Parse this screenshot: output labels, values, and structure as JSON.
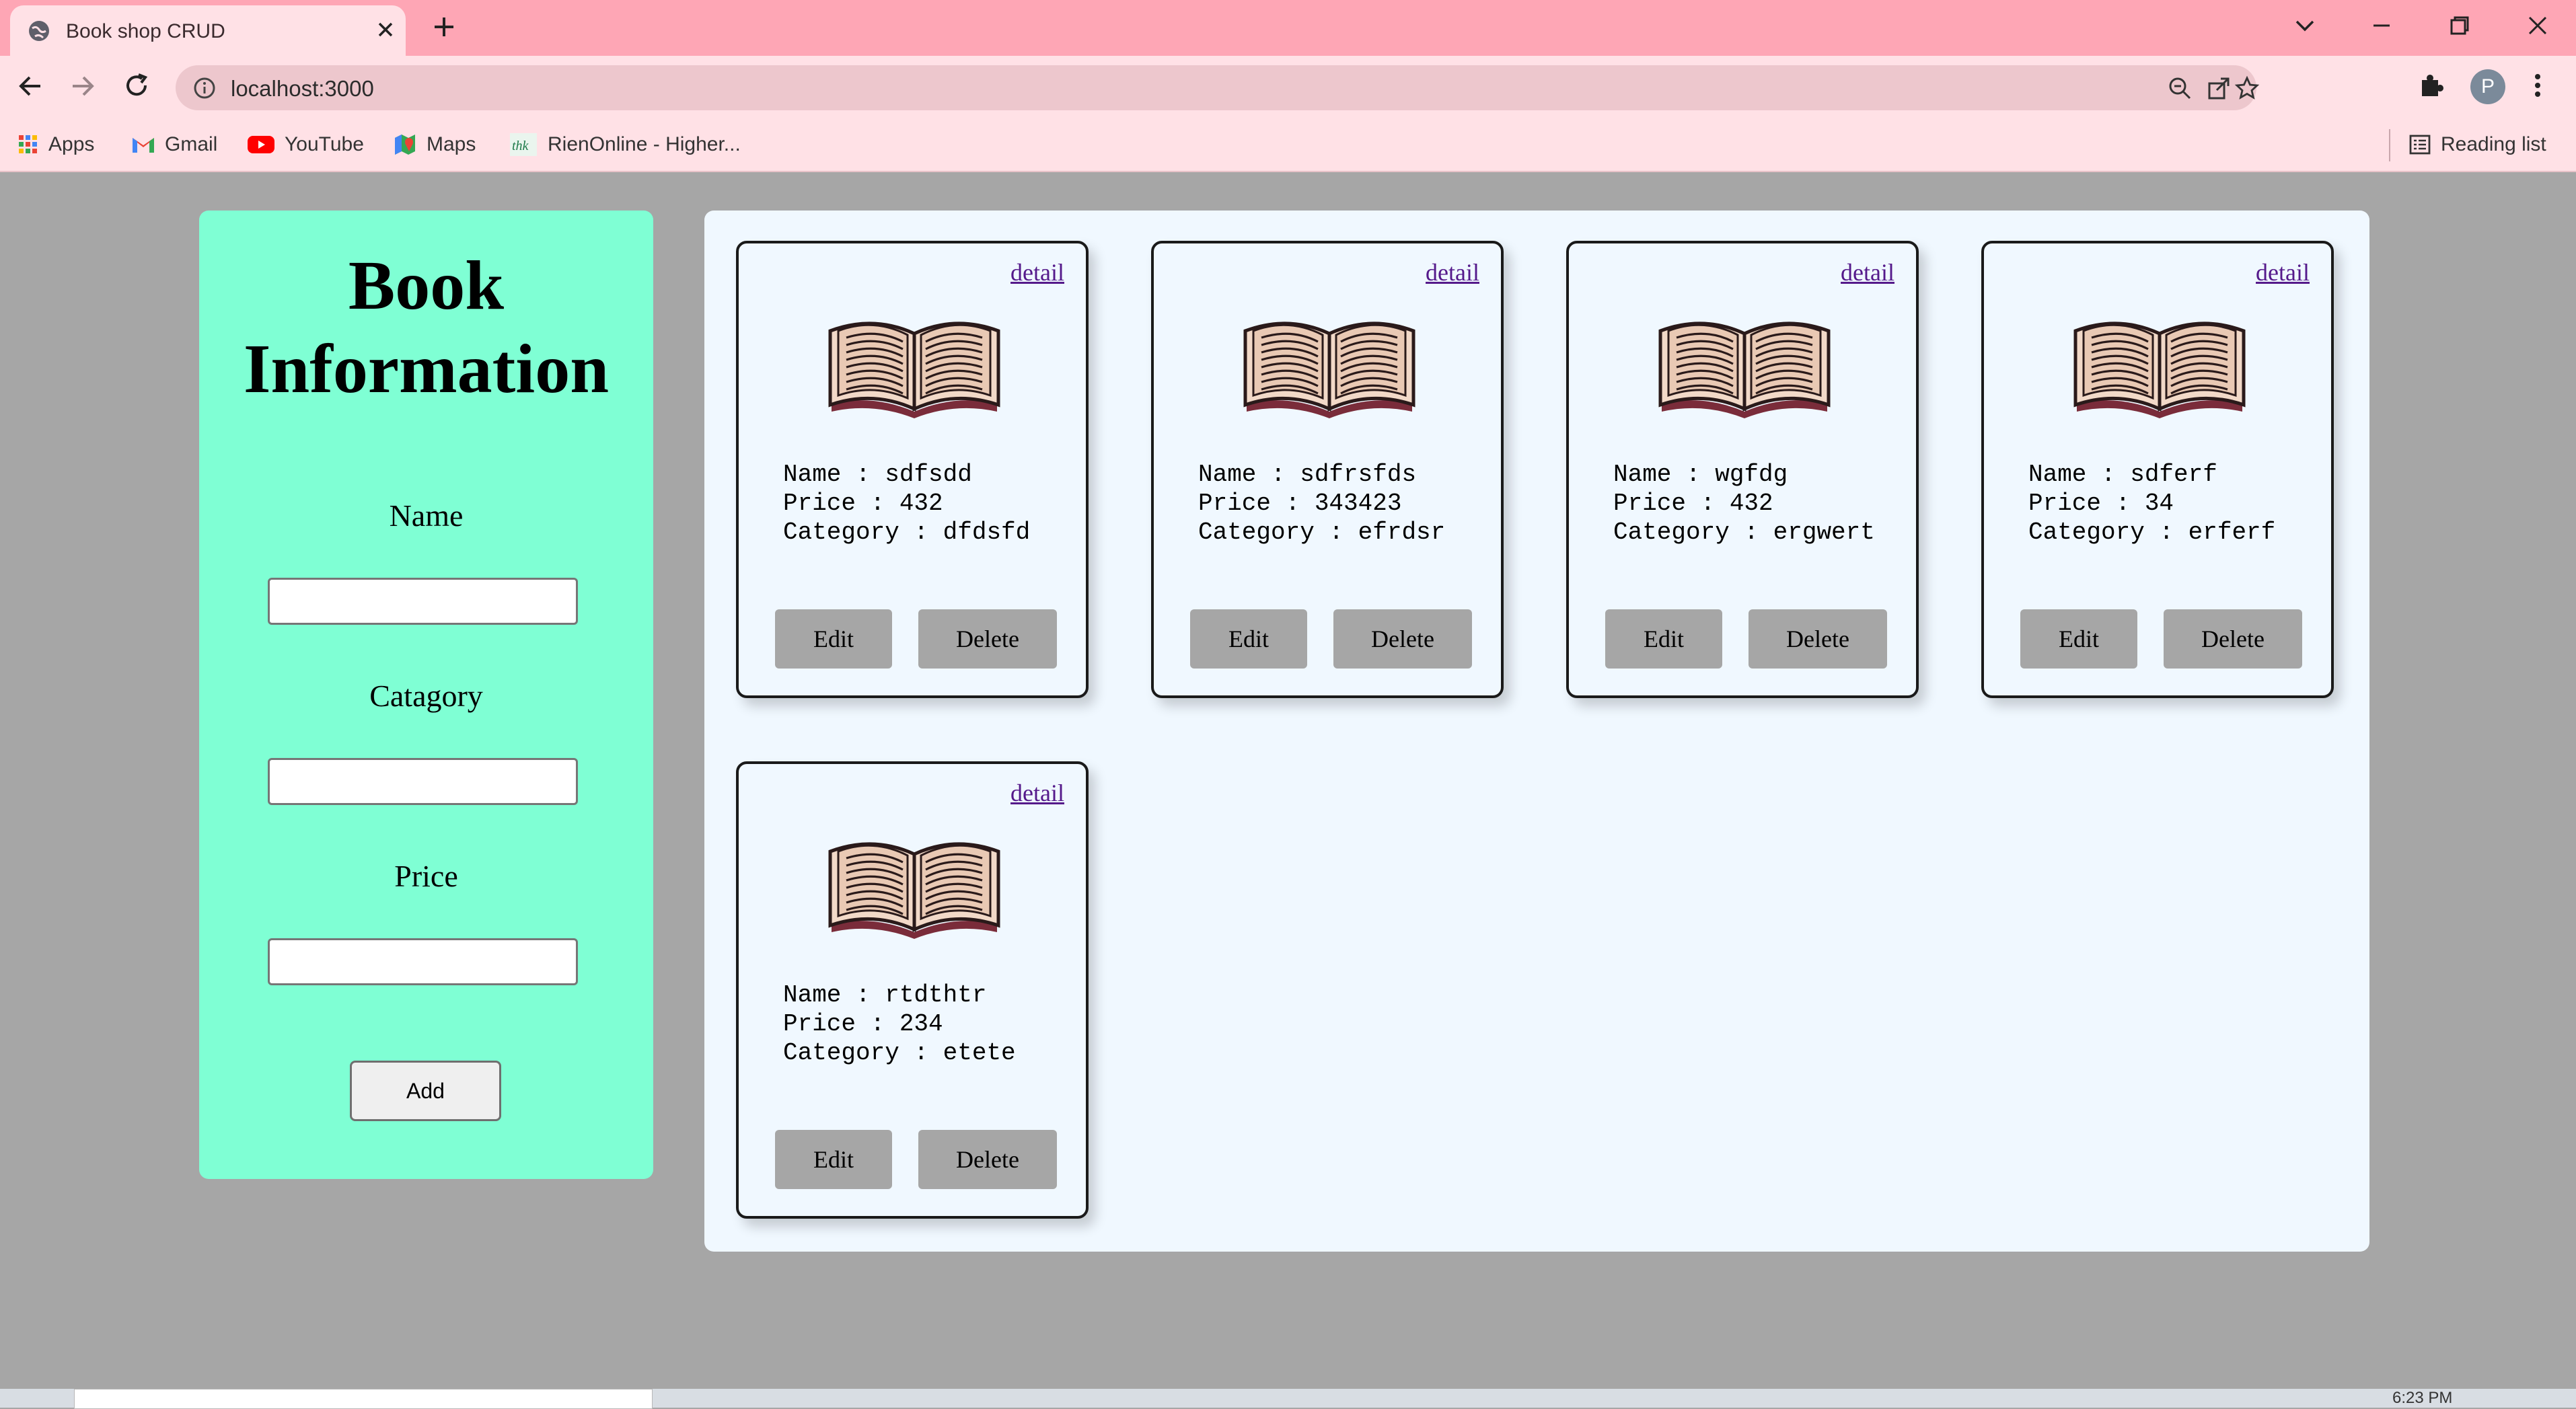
{
  "browser": {
    "tab_title": "Book shop CRUD",
    "url": "localhost:3000",
    "bookmarks": [
      "Apps",
      "Gmail",
      "YouTube",
      "Maps",
      "RienOnline - Higher..."
    ],
    "reading_list": "Reading list",
    "profile_initial": "P"
  },
  "form": {
    "title_line1": "Book",
    "title_line2": "Information",
    "name_label": "Name",
    "category_label": "Catagory",
    "price_label": "Price",
    "add_label": "Add"
  },
  "cards": [
    {
      "detail": "detail",
      "name": "Name : sdfsdd",
      "price": "Price : 432",
      "category": "Category : dfdsfd",
      "edit": "Edit",
      "delete": "Delete"
    },
    {
      "detail": "detail",
      "name": "Name : sdfrsfds",
      "price": "Price : 343423",
      "category": "Category : efrdsr",
      "edit": "Edit",
      "delete": "Delete"
    },
    {
      "detail": "detail",
      "name": "Name : wgfdg",
      "price": "Price : 432",
      "category": "Category : ergwert",
      "edit": "Edit",
      "delete": "Delete"
    },
    {
      "detail": "detail",
      "name": "Name : sdferf",
      "price": "Price : 34",
      "category": "Category : erferf",
      "edit": "Edit",
      "delete": "Delete"
    },
    {
      "detail": "detail",
      "name": "Name : rtdthtr",
      "price": "Price : 234",
      "category": "Category : etete",
      "edit": "Edit",
      "delete": "Delete"
    }
  ],
  "taskbar": {
    "time": "6:23 PM"
  },
  "colors": {
    "tabstrip": "#fea6b5",
    "toolbar": "#ffe1e6",
    "page_bg": "#a6a6a6",
    "form_bg": "#7fffd4",
    "cards_bg": "#f0f8ff",
    "button_gray": "#a6a6a6"
  },
  "icons": [
    "globe-icon",
    "close-icon",
    "plus-icon",
    "chevron-down-icon",
    "minimize-icon",
    "restore-icon",
    "back-icon",
    "forward-icon",
    "reload-icon",
    "info-icon",
    "zoom-out-icon",
    "share-icon",
    "star-icon",
    "extensions-icon",
    "menu-icon",
    "apps-grid-icon",
    "gmail-icon",
    "youtube-icon",
    "maps-icon",
    "rien-icon",
    "reading-list-icon",
    "open-book-icon"
  ]
}
